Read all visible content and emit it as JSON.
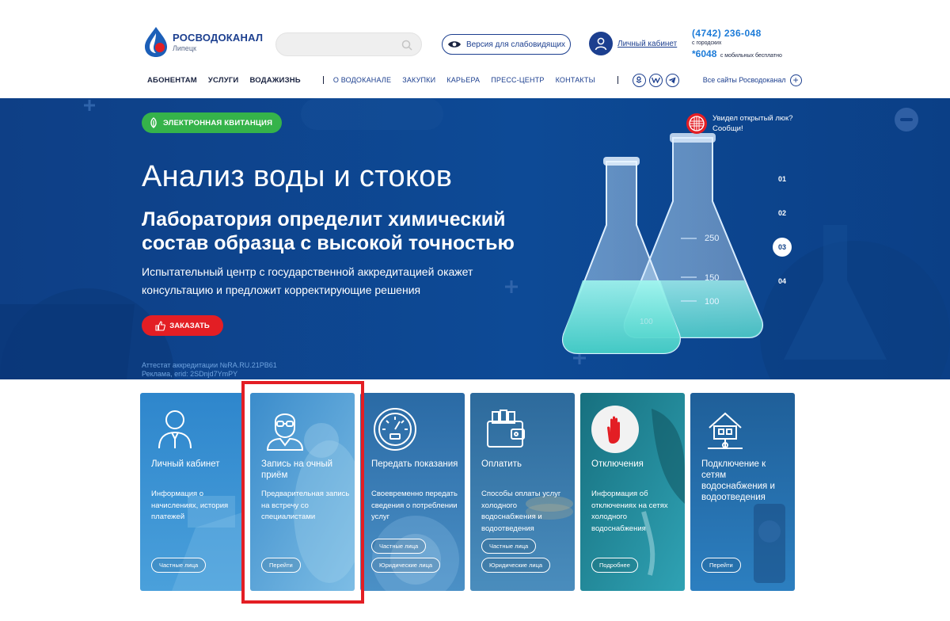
{
  "header": {
    "logo_brand": "РОСВОДОКАНАЛ",
    "logo_city": "Липецк",
    "search_placeholder": "",
    "vision_label": "Версия для слабовидящих",
    "account_label": "Личный кабинет",
    "phone_main": "(4742) 236-048",
    "phone_main_note": "с городских",
    "phone_short": "*6048",
    "phone_short_note": "с мобильных бесплатно"
  },
  "nav": {
    "main": [
      "АБОНЕНТАМ",
      "УСЛУГИ",
      "ВОДАЖИЗНЬ"
    ],
    "secondary": [
      "О ВОДОКАНАЛЕ",
      "ЗАКУПКИ",
      "КАРЬЕРА",
      "ПРЕСС-ЦЕНТР",
      "КОНТАКТЫ"
    ],
    "social": [
      "ok-icon",
      "vk-icon",
      "telegram-icon"
    ],
    "all_sites": "Все сайты Росводоканал"
  },
  "hero": {
    "ekv_label": "ЭЛЕКТРОННАЯ КВИТАНЦИЯ",
    "title": "Анализ воды и стоков",
    "subtitle": "Лаборатория определит химический состав образца с высокой точностью",
    "description": "Испытательный центр с государственной аккредитацией окажет консультацию и предложит корректирующие решения",
    "order_label": "ЗАКАЗАТЬ",
    "note_line1": "Аттестат аккредитации №RA.RU.21PB61",
    "note_line2": "Реклама, erid: 2SDnjd7YmPY",
    "hatch_text": "Увидел открытый люк? Сообщи!",
    "slides": [
      "01",
      "02",
      "03",
      "04"
    ],
    "active_slide": "03",
    "flask_marks": [
      "250",
      "150",
      "100",
      "100"
    ]
  },
  "cards": [
    {
      "title": "Личный кабинет",
      "text": "Информация о начислениях, история платежей",
      "pills": [
        "Частные лица"
      ],
      "icon": "person-icon",
      "colors": [
        "#2c82c9",
        "#3a96d8"
      ]
    },
    {
      "title": "Запись на очный приём",
      "text": "Предварительная запись на встречу со специалистами",
      "pills": [
        "Перейти"
      ],
      "icon": "specialist-icon",
      "colors": [
        "#3e8fca",
        "#66b0de"
      ]
    },
    {
      "title": "Передать показания",
      "text": "Своевременно передать сведения о потреблении услуг",
      "pills": [
        "Частные лица",
        "Юридические лица"
      ],
      "icon": "meter-icon",
      "colors": [
        "#2d6fa8",
        "#4f95c9"
      ]
    },
    {
      "title": "Оплатить",
      "text": "Способы оплаты услуг холодного водоснабжения и водоотведения",
      "pills": [
        "Частные лица",
        "Юридические лица"
      ],
      "icon": "wallet-icon",
      "colors": [
        "#2f6ea0",
        "#4a8cbc"
      ]
    },
    {
      "title": "Отключения",
      "text": "Информация об отключениях на сетях холодного водоснабжения",
      "pills": [
        "Подробнее"
      ],
      "icon": "stop-hand-icon",
      "colors": [
        "#1f7a8c",
        "#2d9db2"
      ]
    },
    {
      "title": "Подключение к сетям водоснабжения и водоотведения",
      "text": "",
      "pills": [
        "Перейти"
      ],
      "icon": "house-connection-icon",
      "colors": [
        "#1f5d95",
        "#2d7cbc"
      ]
    }
  ]
}
